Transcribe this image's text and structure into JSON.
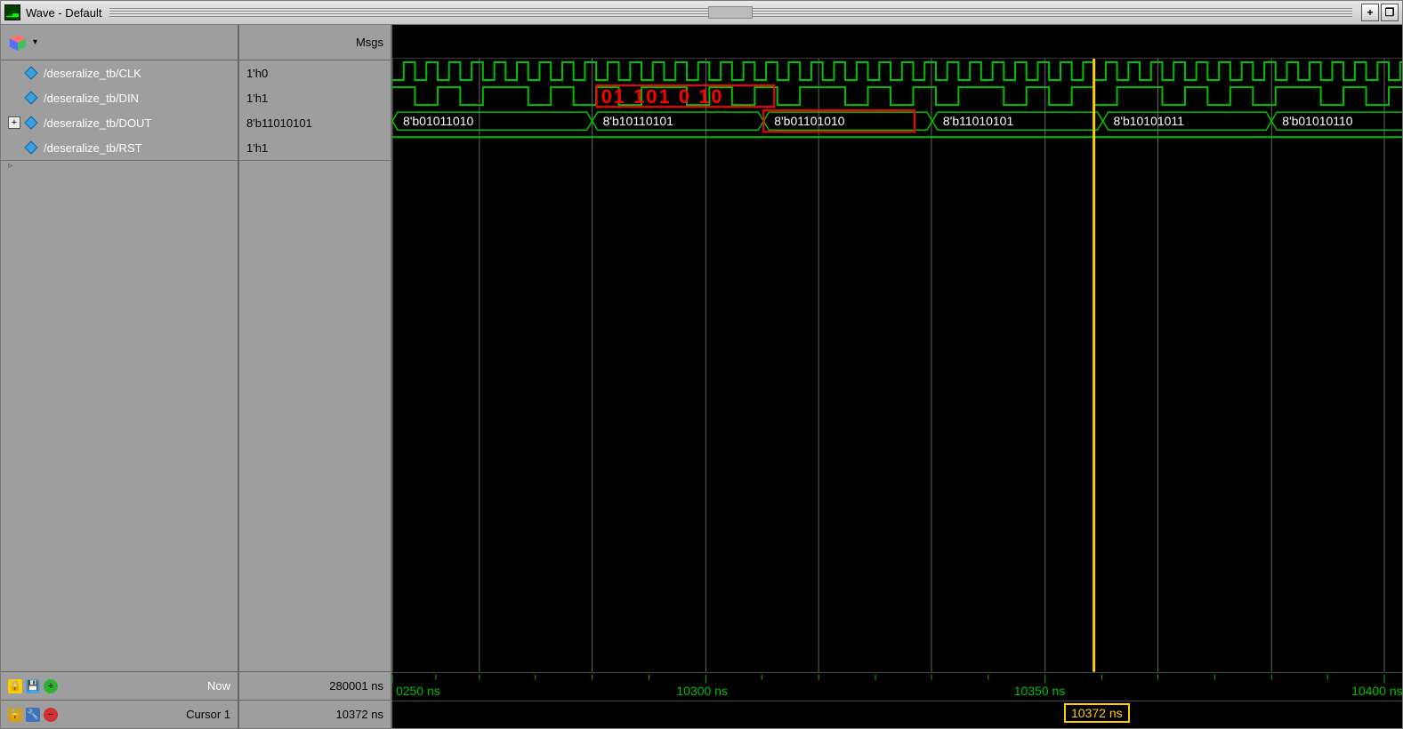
{
  "window": {
    "title": "Wave - Default"
  },
  "header": {
    "msgs_label": "Msgs"
  },
  "signals": [
    {
      "name": "/deseralize_tb/CLK",
      "value": "1'h0",
      "expandable": false
    },
    {
      "name": "/deseralize_tb/DIN",
      "value": "1'h1",
      "expandable": false
    },
    {
      "name": "/deseralize_tb/DOUT",
      "value": "8'b11010101",
      "expandable": true
    },
    {
      "name": "/deseralize_tb/RST",
      "value": "1'h1",
      "expandable": false
    }
  ],
  "bus_values": [
    "8'b01011010",
    "8'b10110101",
    "8'b01101010",
    "8'b11010101",
    "8'b10101011",
    "8'b01010110"
  ],
  "annotation": {
    "overlay_bits": "01 101 0 10"
  },
  "footer": {
    "now_label": "Now",
    "now_value": "280001 ns",
    "cursor_label": "Cursor 1",
    "cursor_value": "10372 ns"
  },
  "ruler": {
    "ticks": [
      "0250 ns",
      "10300 ns",
      "10350 ns",
      "10400 ns"
    ],
    "cursor_tag": "10372 ns"
  },
  "titlebar_buttons": {
    "plus": "+",
    "max": "❐"
  }
}
